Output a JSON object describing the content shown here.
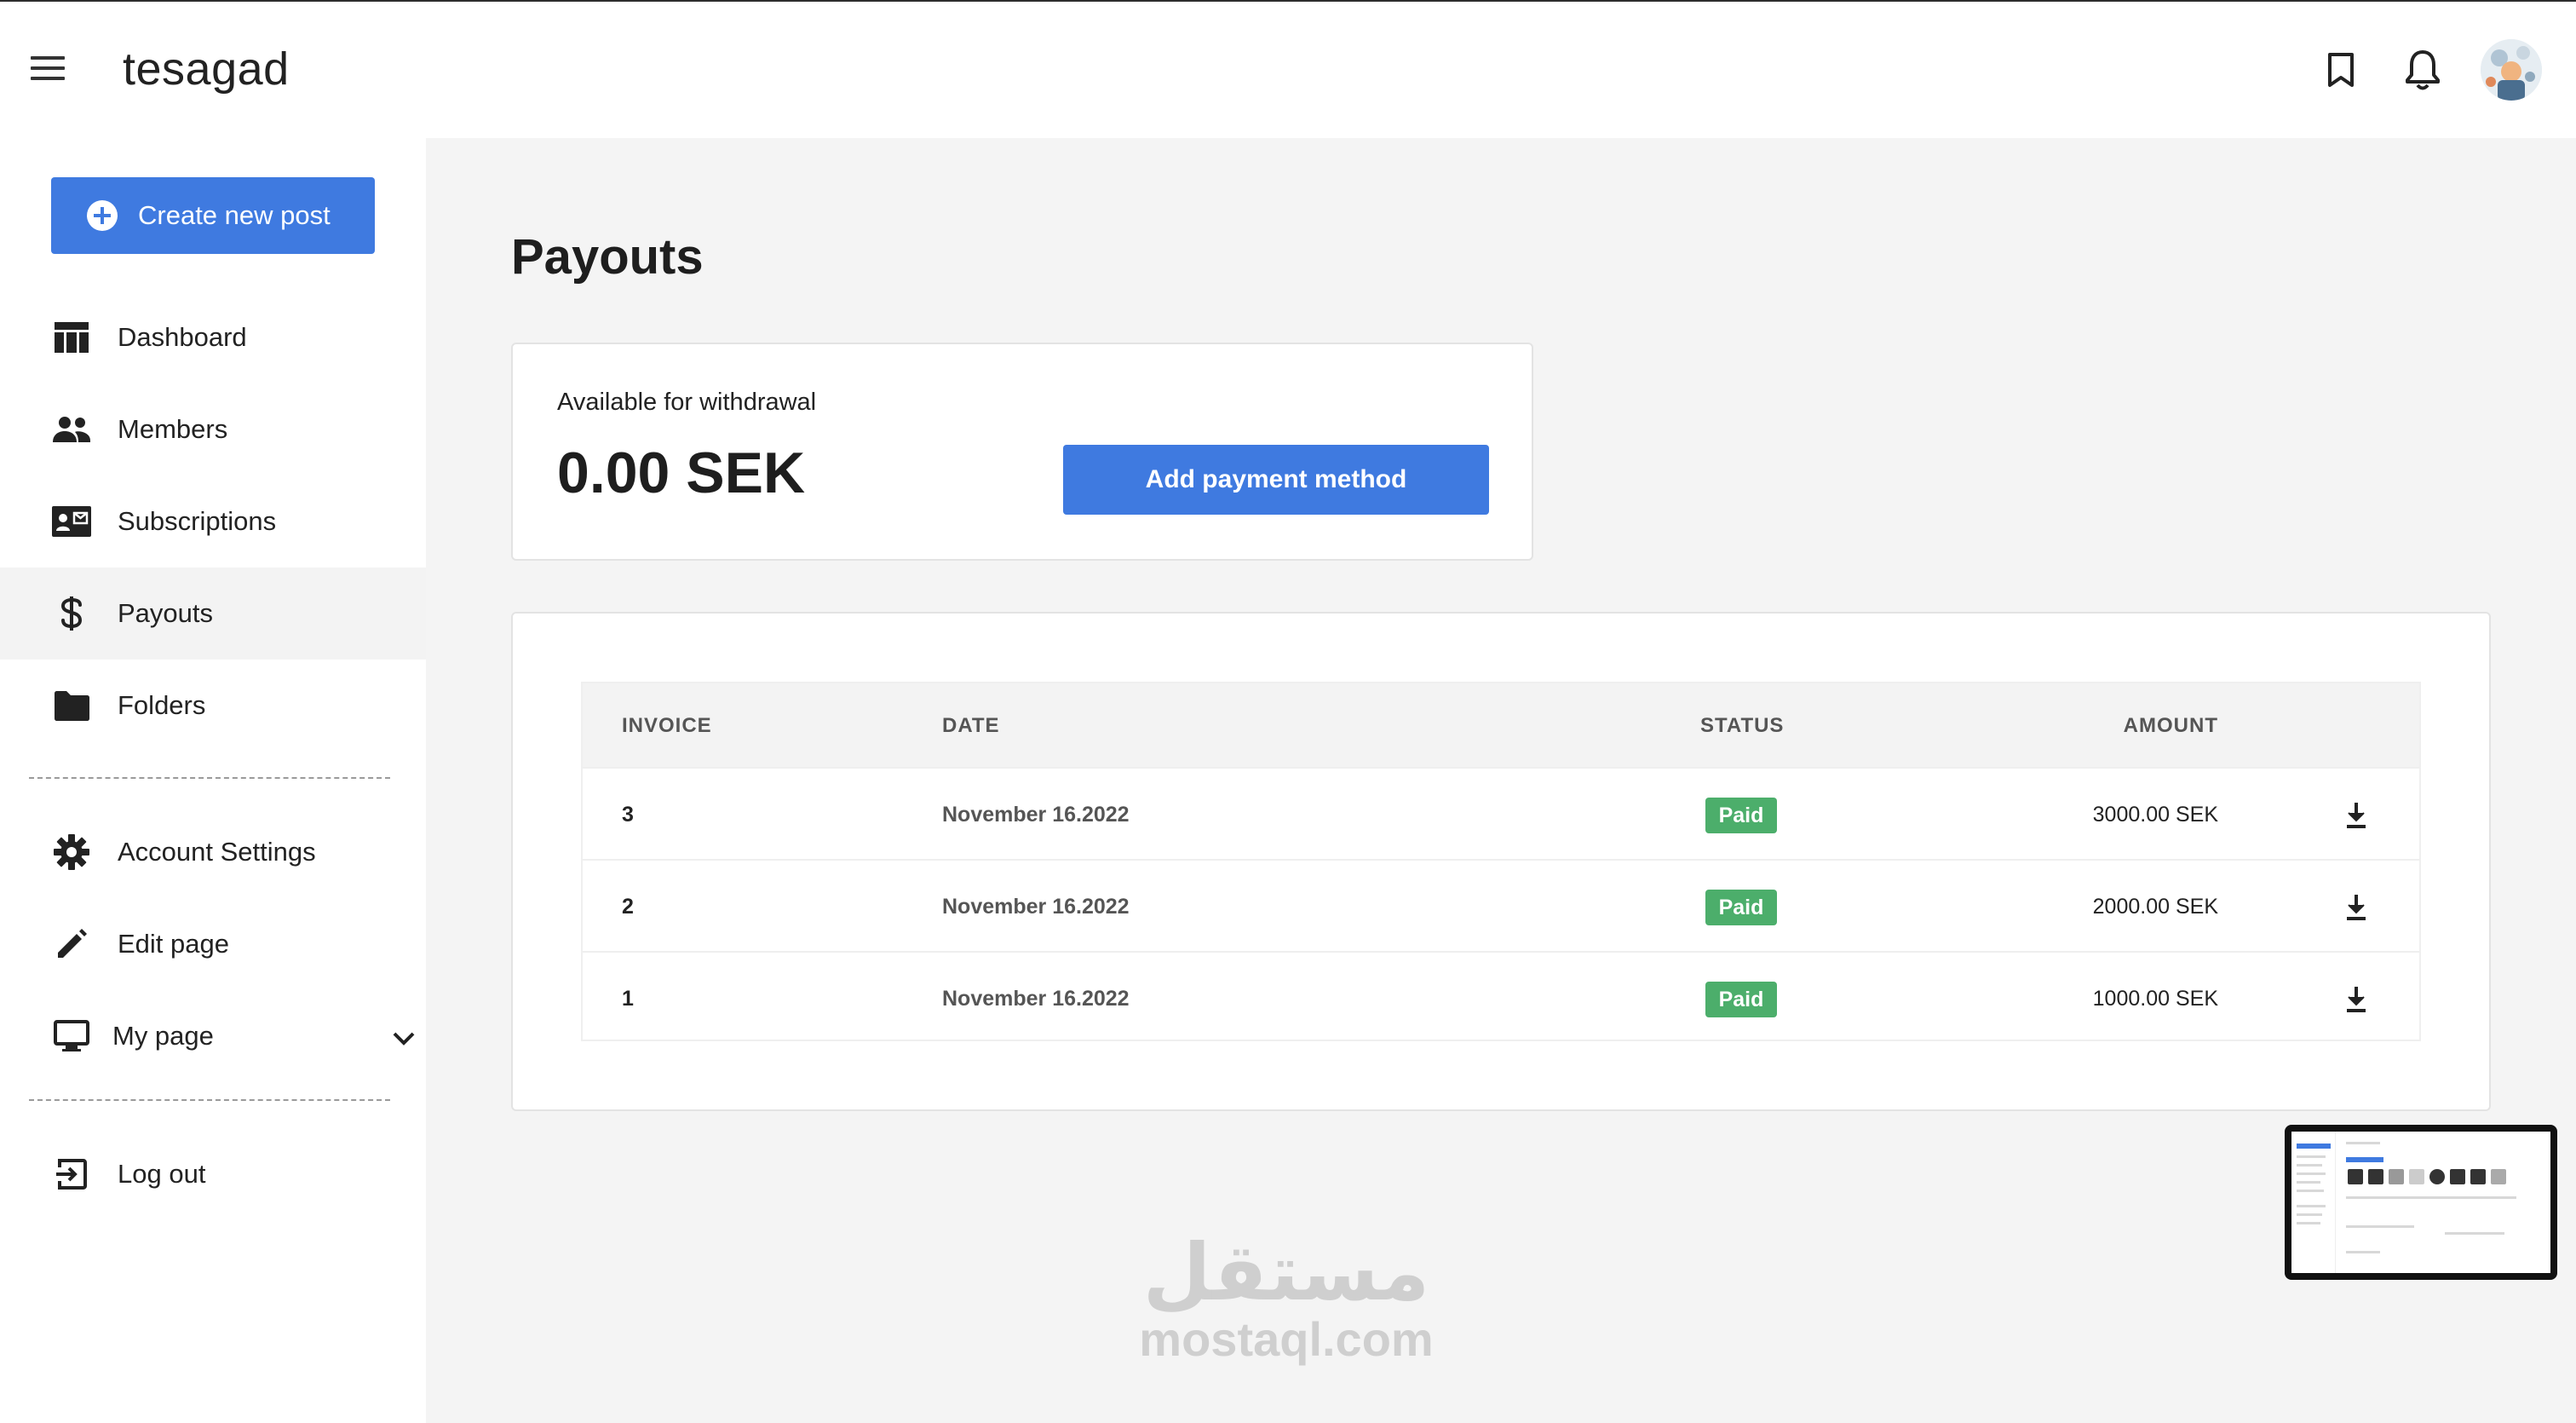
{
  "app": {
    "title": "tesagad"
  },
  "header": {
    "icons": [
      "menu-icon",
      "bookmark-icon",
      "bell-icon",
      "avatar"
    ]
  },
  "sidebar": {
    "create_label": "Create new post",
    "items": [
      {
        "label": "Dashboard",
        "icon": "dashboard-icon"
      },
      {
        "label": "Members",
        "icon": "members-icon"
      },
      {
        "label": "Subscriptions",
        "icon": "subscriptions-icon"
      },
      {
        "label": "Payouts",
        "icon": "dollar-icon",
        "active": true
      },
      {
        "label": "Folders",
        "icon": "folder-icon"
      }
    ],
    "settings": [
      {
        "label": "Account Settings",
        "icon": "gear-icon"
      },
      {
        "label": "Edit page",
        "icon": "pencil-icon"
      },
      {
        "label": "My page",
        "icon": "monitor-icon"
      }
    ],
    "logout_label": "Log out"
  },
  "main": {
    "title": "Payouts",
    "balance": {
      "label": "Available for withdrawal",
      "value": "0.00 SEK",
      "button": "Add payment method"
    },
    "table": {
      "headers": [
        "INVOICE",
        "DATE",
        "STATUS",
        "AMOUNT"
      ],
      "rows": [
        {
          "invoice": "3",
          "date": "November 16.2022",
          "status": "Paid",
          "amount": "3000.00 SEK"
        },
        {
          "invoice": "2",
          "date": "November 16.2022",
          "status": "Paid",
          "amount": "2000.00 SEK"
        },
        {
          "invoice": "1",
          "date": "November 16.2022",
          "status": "Paid",
          "amount": "1000.00 SEK"
        }
      ]
    }
  },
  "watermark": {
    "arabic": "مستقل",
    "latin": "mostaql.com"
  },
  "colors": {
    "accent": "#3f7ae0",
    "paid": "#4cae6b",
    "main_bg": "#f4f4f4"
  }
}
